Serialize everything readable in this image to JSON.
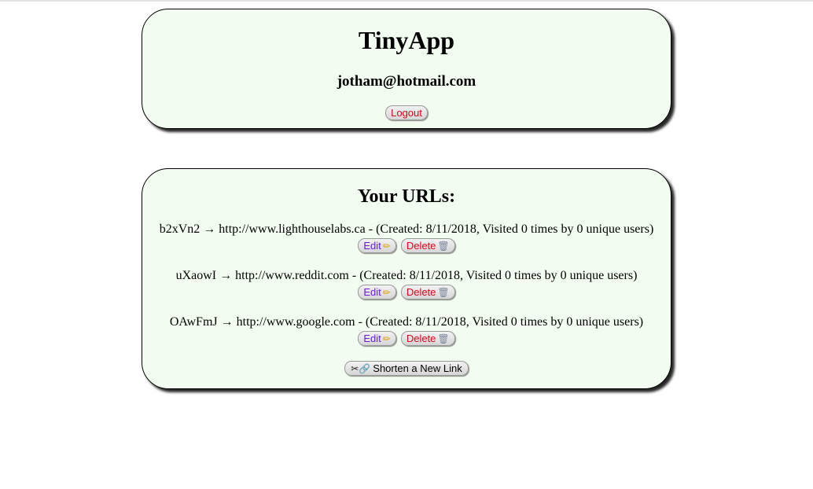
{
  "header": {
    "title": "TinyApp",
    "email": "jotham@hotmail.com",
    "logout_label": "Logout"
  },
  "urls_section": {
    "title": "Your URLs:",
    "items": [
      {
        "short_id": "b2xVn2",
        "arrow": "→",
        "long_url": "http://www.lighthouselabs.ca",
        "details": "- (Created: 8/11/2018, Visited 0 times by 0 unique users)",
        "edit_label": "Edit",
        "delete_label": "Delete"
      },
      {
        "short_id": "uXaowI",
        "arrow": "→",
        "long_url": "http://www.reddit.com",
        "details": "- (Created: 8/11/2018, Visited 0 times by 0 unique users)",
        "edit_label": "Edit",
        "delete_label": "Delete"
      },
      {
        "short_id": "OAwFmJ",
        "arrow": "→",
        "long_url": "http://www.google.com",
        "details": "- (Created: 8/11/2018, Visited 0 times by 0 unique users)",
        "edit_label": "Edit",
        "delete_label": "Delete"
      }
    ],
    "shorten_label": "Shorten a New Link"
  },
  "icons": {
    "edit": "pencil-icon",
    "delete": "trash-icon",
    "shorten": [
      "scissors-icon",
      "link-icon"
    ]
  },
  "colors": {
    "card_background": "#f3fcf0",
    "danger_text": "#e0001b",
    "edit_text": "#6a1fd6"
  }
}
